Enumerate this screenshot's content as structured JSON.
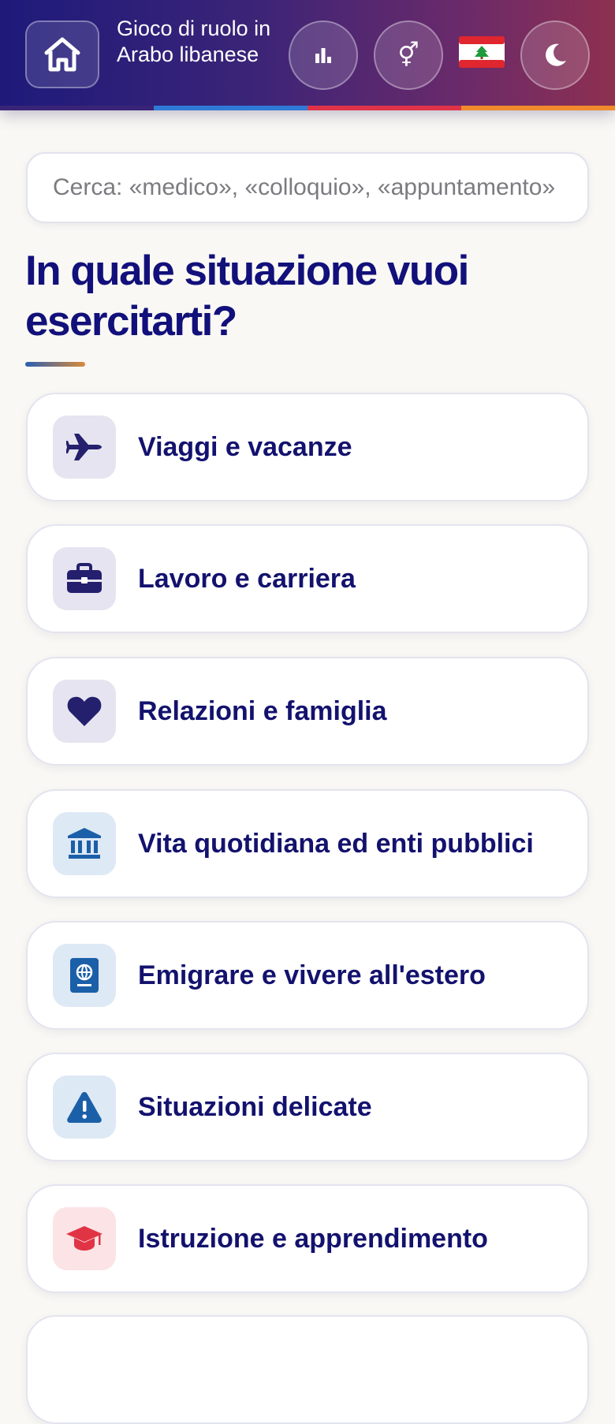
{
  "header": {
    "title": "Gioco di ruolo in Arabo libanese",
    "home_icon": "home-icon",
    "stats_icon": "bar-chart-icon",
    "gender_icon": "gender-icon",
    "flag": "🇱🇧",
    "theme_icon": "moon-icon",
    "gender_glyph": "⚥",
    "stripe_colors": [
      "#3a2478",
      "#2f7ad6",
      "#e0334a",
      "#f08a2c"
    ]
  },
  "search": {
    "placeholder": "Cerca: «medico», «colloquio», «appuntamento»"
  },
  "page_heading": "In quale situazione vuoi esercitarti?",
  "categories": [
    {
      "label": "Viaggi e vacanze",
      "icon": "airplane-icon",
      "icon_bg": "#e6e4f0",
      "icon_color": "#24206e"
    },
    {
      "label": "Lavoro e carriera",
      "icon": "briefcase-icon",
      "icon_bg": "#e6e4f0",
      "icon_color": "#24206e"
    },
    {
      "label": "Relazioni e famiglia",
      "icon": "heart-icon",
      "icon_bg": "#e6e4f0",
      "icon_color": "#24206e"
    },
    {
      "label": "Vita quotidiana ed enti pubblici",
      "icon": "government-building-icon",
      "icon_bg": "#dde9f5",
      "icon_color": "#1b5fa8"
    },
    {
      "label": "Emigrare e vivere all'estero",
      "icon": "passport-icon",
      "icon_bg": "#dde9f5",
      "icon_color": "#1b5fa8"
    },
    {
      "label": "Situazioni delicate",
      "icon": "warning-icon",
      "icon_bg": "#dde9f5",
      "icon_color": "#1b5fa8"
    },
    {
      "label": "Istruzione e apprendimento",
      "icon": "graduation-cap-icon",
      "icon_bg": "#fbe3e6",
      "icon_color": "#e03444"
    }
  ]
}
